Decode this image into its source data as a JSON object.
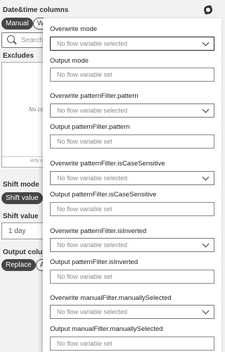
{
  "background": {
    "title": "Date&time columns",
    "mode_pills": [
      "Manual",
      "W"
    ],
    "search_placeholder": "Search",
    "excludes_label": "Excludes",
    "excludes_empty_text": "No co",
    "excludes_footer_text": "Arty u",
    "shift_mode_label": "Shift mode",
    "shift_mode_pills": [
      "Shift value"
    ],
    "shift_value_label": "Shift value",
    "shift_value_input": "1 day",
    "output_columns_label": "Output column",
    "output_pills": [
      "Replace",
      "A"
    ]
  },
  "popover": {
    "fields": [
      {
        "label": "Overwrite mode",
        "type": "select",
        "value": "No flow variable selected"
      },
      {
        "label": "Output mode",
        "type": "text",
        "value": "No flow variable set"
      },
      {
        "label": "Overwrite patternFilter.pattern",
        "type": "select",
        "value": "No flow variable selected"
      },
      {
        "label": "Output patternFilter.pattern",
        "type": "text",
        "value": "No flow variable set"
      },
      {
        "label": "Overwrite patternFilter.isCaseSensitive",
        "type": "select",
        "value": "No flow variable selected"
      },
      {
        "label": "Output patternFilter.isCaseSensitive",
        "type": "text",
        "value": "No flow variable set"
      },
      {
        "label": "Overwrite patternFilter.isInverted",
        "type": "select",
        "value": "No flow variable selected"
      },
      {
        "label": "Output patternFilter.isInverted",
        "type": "text",
        "value": "No flow variable set"
      },
      {
        "label": "Overwrite manualFilter.manuallySelected",
        "type": "select",
        "value": "No flow variable selected"
      },
      {
        "label": "Output manualFilter.manuallySelected",
        "type": "text",
        "value": "No flow variable set"
      }
    ]
  }
}
